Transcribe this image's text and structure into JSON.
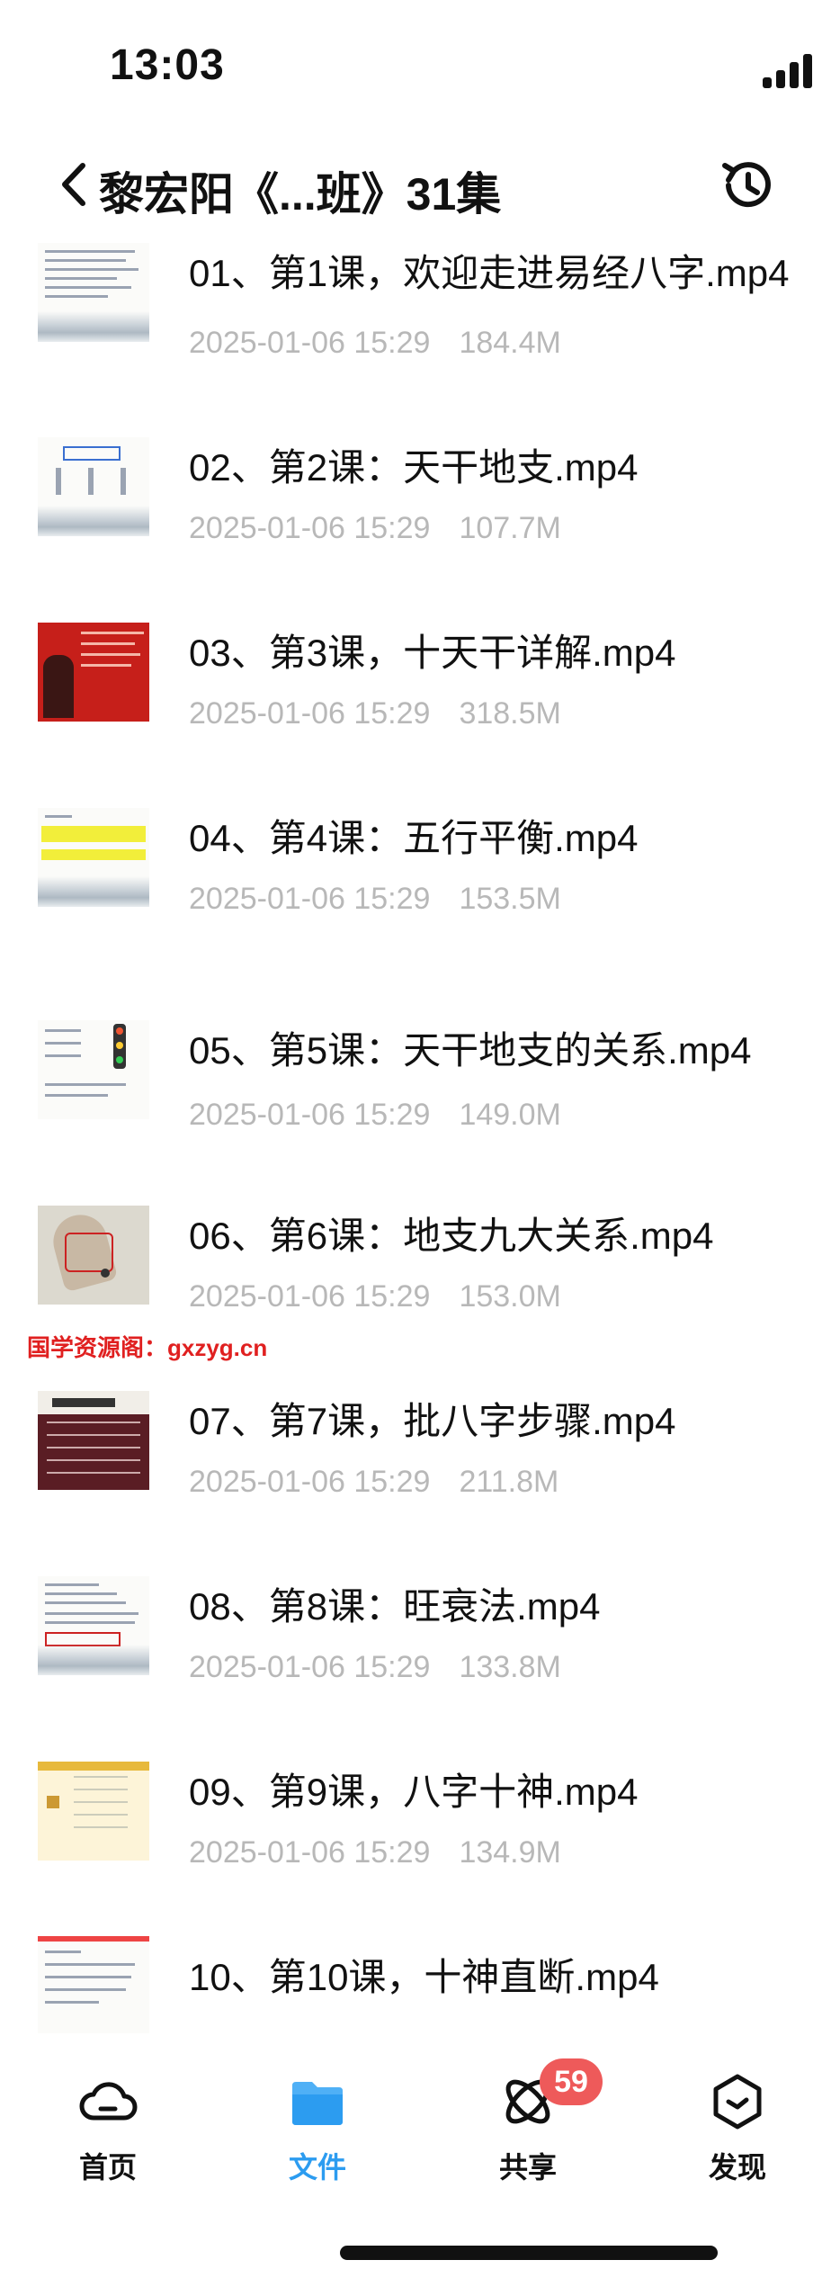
{
  "status_bar": {
    "time": "13:03"
  },
  "nav": {
    "title": "黎宏阳《...班》31集"
  },
  "files": [
    {
      "name": "01、第1课，欢迎走进易经八字.mp4",
      "date": "2025-01-06 15:29",
      "size": "184.4M"
    },
    {
      "name": "02、第2课：天干地支.mp4",
      "date": "2025-01-06 15:29",
      "size": "107.7M"
    },
    {
      "name": "03、第3课，十天干详解.mp4",
      "date": "2025-01-06 15:29",
      "size": "318.5M"
    },
    {
      "name": "04、第4课：五行平衡.mp4",
      "date": "2025-01-06 15:29",
      "size": "153.5M"
    },
    {
      "name": "05、第5课：天干地支的关系.mp4",
      "date": "2025-01-06 15:29",
      "size": "149.0M"
    },
    {
      "name": "06、第6课：地支九大关系.mp4",
      "date": "2025-01-06 15:29",
      "size": "153.0M"
    },
    {
      "name": "07、第7课，批八字步骤.mp4",
      "date": "2025-01-06 15:29",
      "size": "211.8M"
    },
    {
      "name": "08、第8课：旺衰法.mp4",
      "date": "2025-01-06 15:29",
      "size": "133.8M"
    },
    {
      "name": "09、第9课，八字十神.mp4",
      "date": "2025-01-06 15:29",
      "size": "134.9M"
    },
    {
      "name": "10、第10课，十神直断.mp4",
      "date": "",
      "size": ""
    }
  ],
  "watermark": "国学资源阁：gxzyg.cn",
  "tabs": [
    {
      "label": "首页",
      "icon": "cloud-icon",
      "active": false
    },
    {
      "label": "文件",
      "icon": "folder-icon",
      "active": true
    },
    {
      "label": "共享",
      "icon": "share-orbit-icon",
      "active": false,
      "badge": "59"
    },
    {
      "label": "发现",
      "icon": "discover-icon",
      "active": false
    }
  ],
  "colors": {
    "accent": "#2c9cf0",
    "badge": "#ee5a5a",
    "meta_text": "#b8b8b8"
  }
}
